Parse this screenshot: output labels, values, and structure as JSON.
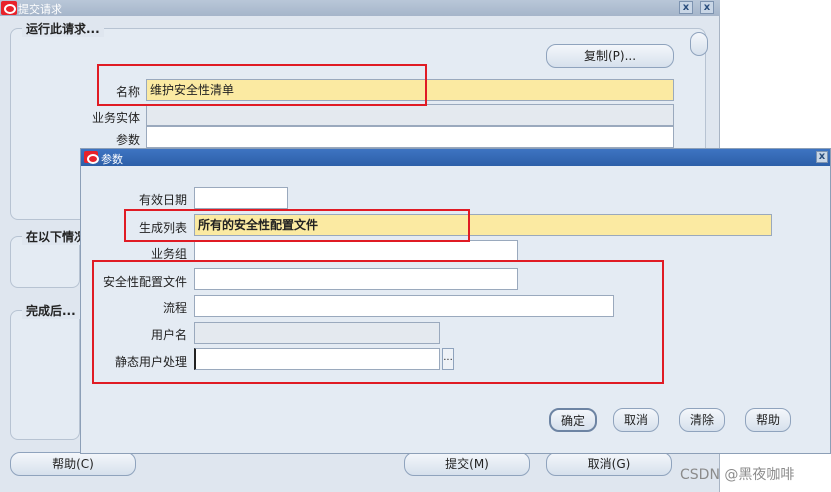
{
  "main_window": {
    "title": "提交请求",
    "close_glyph": "x",
    "groups": {
      "run_this": "运行此请求...",
      "conditions": "在以下情况",
      "upon_completion": "完成后..."
    },
    "copy_button": "复制(P)...",
    "fields": {
      "name_label": "名称",
      "name_value": "维护安全性清单",
      "operating_unit_label": "业务实体",
      "parameters_label": "参数"
    },
    "bottom_buttons": {
      "help": "帮助(C)",
      "submit": "提交(M)",
      "cancel": "取消(G)"
    }
  },
  "parameters_dialog": {
    "title": "参数",
    "close_glyph": "x",
    "fields": [
      {
        "label": "有效日期",
        "value": ""
      },
      {
        "label": "生成列表",
        "value": "所有的安全性配置文件"
      },
      {
        "label": "业务组",
        "value": ""
      },
      {
        "label": "安全性配置文件",
        "value": ""
      },
      {
        "label": "流程",
        "value": ""
      },
      {
        "label": "用户名",
        "value": ""
      },
      {
        "label": "静态用户处理",
        "value": ""
      }
    ],
    "lov_button_glyph": "...",
    "buttons": {
      "ok": "确定",
      "cancel": "取消",
      "clear": "清除",
      "help": "帮助"
    }
  },
  "watermark": "CSDN @黑夜咖啡",
  "colors": {
    "title_active": "#2d5fa8",
    "highlight_field": "#fbeaa2",
    "annotation_red": "#e01b24",
    "oracle_red": "#e8222a"
  }
}
